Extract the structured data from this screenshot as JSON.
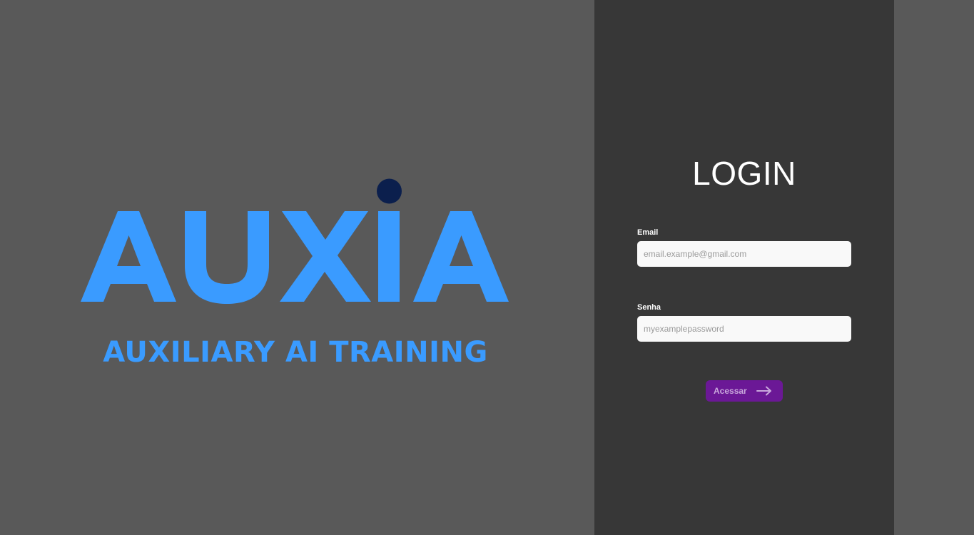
{
  "brand": {
    "logo_text": "AUXiA",
    "tagline": "AUXILIARY AI TRAINING",
    "colors": {
      "logo_blue": "#3a9bff",
      "logo_dot": "#0b1f4d"
    }
  },
  "login": {
    "title": "LOGIN",
    "email": {
      "label": "Email",
      "placeholder": "email.example@gmail.com",
      "value": ""
    },
    "password": {
      "label": "Senha",
      "placeholder": "myexamplepassword",
      "value": ""
    },
    "submit": {
      "label": "Acessar",
      "icon": "arrow-right-icon"
    },
    "colors": {
      "panel_bg": "#373737",
      "button_bg": "#6b1896"
    }
  }
}
